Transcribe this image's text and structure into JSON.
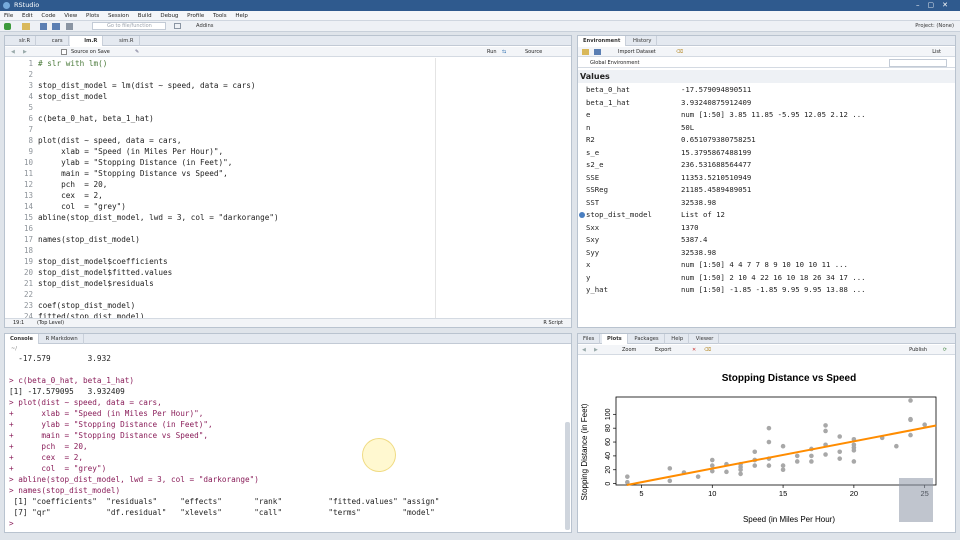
{
  "window": {
    "title": "RStudio"
  },
  "menu": [
    "File",
    "Edit",
    "Code",
    "View",
    "Plots",
    "Session",
    "Build",
    "Debug",
    "Profile",
    "Tools",
    "Help"
  ],
  "toolbar": {
    "goto_placeholder": "Go to file/function",
    "addins": "Addins",
    "project": "Project: (None)"
  },
  "editor": {
    "tabs": [
      "slr.R",
      "cars",
      "lm.R",
      "sim.R"
    ],
    "source_on_save": "Source on Save",
    "run": "Run",
    "source": "Source",
    "status_pos": "19:1",
    "status_scope": "(Top Level)",
    "status_type": "R Script",
    "lines": [
      {
        "n": "1",
        "t": "# slr with lm()"
      },
      {
        "n": "2",
        "t": ""
      },
      {
        "n": "3",
        "t": "stop_dist_model = lm(dist ~ speed, data = cars)"
      },
      {
        "n": "4",
        "t": "stop_dist_model"
      },
      {
        "n": "5",
        "t": ""
      },
      {
        "n": "6",
        "t": "c(beta_0_hat, beta_1_hat)"
      },
      {
        "n": "7",
        "t": ""
      },
      {
        "n": "8",
        "t": "plot(dist ~ speed, data = cars,"
      },
      {
        "n": "9",
        "t": "     xlab = \"Speed (in Miles Per Hour)\","
      },
      {
        "n": "10",
        "t": "     ylab = \"Stopping Distance (in Feet)\","
      },
      {
        "n": "11",
        "t": "     main = \"Stopping Distance vs Speed\","
      },
      {
        "n": "12",
        "t": "     pch  = 20,"
      },
      {
        "n": "13",
        "t": "     cex  = 2,"
      },
      {
        "n": "14",
        "t": "     col  = \"grey\")"
      },
      {
        "n": "15",
        "t": "abline(stop_dist_model, lwd = 3, col = \"darkorange\")"
      },
      {
        "n": "16",
        "t": ""
      },
      {
        "n": "17",
        "t": "names(stop_dist_model)"
      },
      {
        "n": "18",
        "t": ""
      },
      {
        "n": "19",
        "t": "stop_dist_model$coefficients"
      },
      {
        "n": "20",
        "t": "stop_dist_model$fitted.values"
      },
      {
        "n": "21",
        "t": "stop_dist_model$residuals"
      },
      {
        "n": "22",
        "t": ""
      },
      {
        "n": "23",
        "t": "coef(stop_dist_model)"
      },
      {
        "n": "24",
        "t": "fitted(stop_dist_model)"
      }
    ]
  },
  "console": {
    "tabs": [
      "Console",
      "R Markdown"
    ],
    "path": "~/",
    "lines": [
      {
        "c": "out",
        "t": "  -17.579        3.932"
      },
      {
        "c": "out",
        "t": ""
      },
      {
        "c": "in",
        "t": "> c(beta_0_hat, beta_1_hat)"
      },
      {
        "c": "out",
        "t": "[1] -17.579095   3.932409"
      },
      {
        "c": "in",
        "t": "> plot(dist ~ speed, data = cars,"
      },
      {
        "c": "in",
        "t": "+      xlab = \"Speed (in Miles Per Hour)\","
      },
      {
        "c": "in",
        "t": "+      ylab = \"Stopping Distance (in Feet)\","
      },
      {
        "c": "in",
        "t": "+      main = \"Stopping Distance vs Speed\","
      },
      {
        "c": "in",
        "t": "+      pch  = 20,"
      },
      {
        "c": "in",
        "t": "+      cex  = 2,"
      },
      {
        "c": "in",
        "t": "+      col  = \"grey\")"
      },
      {
        "c": "in",
        "t": "> abline(stop_dist_model, lwd = 3, col = \"darkorange\")"
      },
      {
        "c": "in",
        "t": "> names(stop_dist_model)"
      },
      {
        "c": "out",
        "t": " [1] \"coefficients\"  \"residuals\"     \"effects\"       \"rank\"          \"fitted.values\" \"assign\""
      },
      {
        "c": "out",
        "t": " [7] \"qr\"            \"df.residual\"   \"xlevels\"       \"call\"          \"terms\"         \"model\""
      },
      {
        "c": "in",
        "t": "> "
      }
    ]
  },
  "environment": {
    "tabs": [
      "Environment",
      "History"
    ],
    "import": "Import Dataset",
    "scope": "Global Environment",
    "view": "List",
    "section": "Values",
    "rows": [
      {
        "name": "beta_0_hat",
        "value": "-17.579094890511"
      },
      {
        "name": "beta_1_hat",
        "value": "3.93240875912409"
      },
      {
        "name": "e",
        "value": "num [1:50] 3.85 11.85 -5.95 12.05 2.12 ..."
      },
      {
        "name": "n",
        "value": "50L"
      },
      {
        "name": "R2",
        "value": "0.651079380758251"
      },
      {
        "name": "s_e",
        "value": "15.3795867488199"
      },
      {
        "name": "s2_e",
        "value": "236.531688564477"
      },
      {
        "name": "SSE",
        "value": "11353.5210510949"
      },
      {
        "name": "SSReg",
        "value": "21185.4589489051"
      },
      {
        "name": "SST",
        "value": "32538.98"
      },
      {
        "name": "stop_dist_model",
        "value": "List of 12",
        "expandable": true
      },
      {
        "name": "Sxx",
        "value": "1370"
      },
      {
        "name": "Sxy",
        "value": "5387.4"
      },
      {
        "name": "Syy",
        "value": "32538.98"
      },
      {
        "name": "x",
        "value": "num [1:50] 4 4 7 7 8 9 10 10 10 11 ..."
      },
      {
        "name": "y",
        "value": "num [1:50] 2 10 4 22 16 10 18 26 34 17 ..."
      },
      {
        "name": "y_hat",
        "value": "num [1:50] -1.85 -1.85 9.95 9.95 13.88 ..."
      }
    ]
  },
  "files": {
    "tabs": [
      "Files",
      "Plots",
      "Packages",
      "Help",
      "Viewer"
    ],
    "zoom": "Zoom",
    "export": "Export",
    "publish": "Publish"
  },
  "chart_data": {
    "type": "scatter",
    "title": "Stopping Distance vs Speed",
    "xlabel": "Speed (in Miles Per Hour)",
    "ylabel": "Stopping Distance (in Feet)",
    "xlim": [
      3.2,
      25.8
    ],
    "ylim": [
      -2,
      125
    ],
    "xticks": [
      5,
      10,
      15,
      20,
      25
    ],
    "yticks": [
      0,
      20,
      40,
      60,
      80,
      100
    ],
    "point_color": "#a8a8a8",
    "line_color": "#ff8c00",
    "line": {
      "intercept": -17.579,
      "slope": 3.932
    },
    "x": [
      4,
      4,
      7,
      7,
      8,
      9,
      10,
      10,
      10,
      11,
      11,
      12,
      12,
      12,
      12,
      13,
      13,
      13,
      13,
      14,
      14,
      14,
      14,
      15,
      15,
      15,
      16,
      16,
      17,
      17,
      17,
      18,
      18,
      18,
      18,
      19,
      19,
      19,
      20,
      20,
      20,
      20,
      20,
      22,
      23,
      24,
      24,
      24,
      24,
      25
    ],
    "y": [
      2,
      10,
      4,
      22,
      16,
      10,
      18,
      26,
      34,
      17,
      28,
      14,
      20,
      24,
      28,
      26,
      34,
      34,
      46,
      26,
      36,
      60,
      80,
      20,
      26,
      54,
      32,
      40,
      32,
      40,
      50,
      42,
      56,
      76,
      84,
      36,
      46,
      68,
      32,
      48,
      52,
      56,
      64,
      66,
      54,
      70,
      92,
      93,
      120,
      85
    ]
  }
}
